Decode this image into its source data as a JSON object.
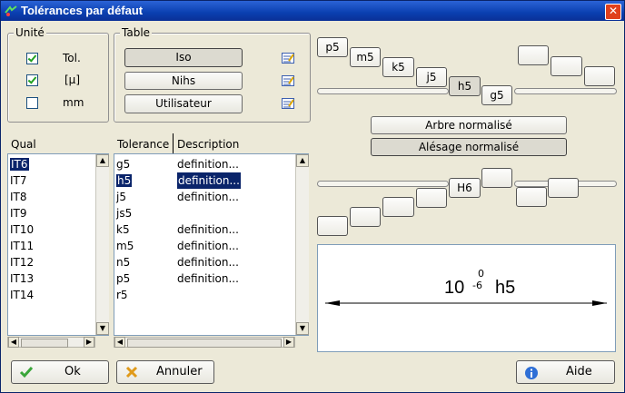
{
  "window": {
    "title": "Tolérances par défaut",
    "close_glyph": "✕"
  },
  "unite": {
    "legend": "Unité",
    "options": [
      {
        "label": "Tol.",
        "checked": true
      },
      {
        "label": "[μ]",
        "checked": true
      },
      {
        "label": "mm",
        "checked": false
      }
    ]
  },
  "table": {
    "legend": "Table",
    "buttons": [
      {
        "label": "Iso",
        "pressed": true
      },
      {
        "label": "Nihs",
        "pressed": false
      },
      {
        "label": "Utilisateur",
        "pressed": false
      }
    ]
  },
  "shaft_tolerances": [
    "p5",
    "m5",
    "k5",
    "j5",
    "h5",
    "g5"
  ],
  "hole_tolerances": [
    "H6"
  ],
  "arbre_button": "Arbre normalisé",
  "alesage_button": "Alésage normalisé",
  "qual": {
    "header": "Qual",
    "items": [
      "IT6",
      "IT7",
      "IT8",
      "IT9",
      "IT10",
      "IT11",
      "IT12",
      "IT13",
      "IT14"
    ],
    "selected": 0
  },
  "tolerance_list": {
    "header_tol": "Tolerance",
    "header_desc": "Description",
    "rows": [
      {
        "tol": "g5",
        "desc": "definition..."
      },
      {
        "tol": "h5",
        "desc": "definition..."
      },
      {
        "tol": "j5",
        "desc": "definition..."
      },
      {
        "tol": "js5",
        "desc": ""
      },
      {
        "tol": "k5",
        "desc": "definition..."
      },
      {
        "tol": "m5",
        "desc": "definition..."
      },
      {
        "tol": "n5",
        "desc": "definition..."
      },
      {
        "tol": "p5",
        "desc": "definition..."
      },
      {
        "tol": "r5",
        "desc": ""
      }
    ],
    "selected": 1
  },
  "preview": {
    "nominal": "10",
    "upper": "0",
    "lower": "-6",
    "code": "h5"
  },
  "buttons": {
    "ok": "Ok",
    "annuler": "Annuler",
    "aide": "Aide"
  },
  "colors": {
    "title_bar": "#0a3fb0",
    "selection": "#0a246a",
    "check": "#21a121"
  }
}
